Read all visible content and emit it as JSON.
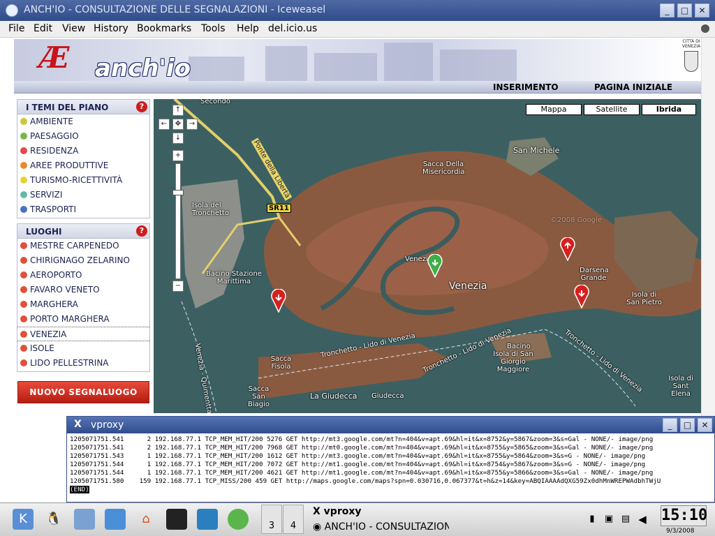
{
  "window": {
    "title": "ANCH'IO - CONSULTAZIONE DELLE SEGNALAZIONI - Iceweasel",
    "menu": [
      "File",
      "Edit",
      "View",
      "History",
      "Bookmarks",
      "Tools",
      "Help",
      "del.icio.us"
    ]
  },
  "banner": {
    "logo_text": "anch'io",
    "city_logo_text": "CITTÀ DI VENEZIA"
  },
  "nav": {
    "inserimento": "INSERIMENTO",
    "pagina_iniziale": "PAGINA INIZIALE"
  },
  "temi": {
    "title": "I TEMI DEL PIANO",
    "help": "?",
    "items": [
      {
        "label": "AMBIENTE",
        "color": "#c8c83a"
      },
      {
        "label": "PAESAGGIO",
        "color": "#7ab648"
      },
      {
        "label": "RESIDENZA",
        "color": "#e04a4a"
      },
      {
        "label": "AREE PRODUTTIVE",
        "color": "#e98a2a"
      },
      {
        "label": "TURISMO-RICETTIVITÀ",
        "color": "#e8d23a"
      },
      {
        "label": "SERVIZI",
        "color": "#62b9a8"
      },
      {
        "label": "TRASPORTI",
        "color": "#4a6fc4"
      }
    ]
  },
  "luoghi": {
    "title": "LUOGHI",
    "help": "?",
    "items": [
      "MESTRE CARPENEDO",
      "CHIRIGNAGO ZELARINO",
      "AEROPORTO",
      "FAVARO VENETO",
      "MARGHERA",
      "PORTO MARGHERA",
      "VENEZIA",
      "ISOLE",
      "LIDO PELLESTRINA"
    ],
    "selected": "VENEZIA",
    "dot_color": "#e0503a"
  },
  "new_button": "NUOVO SEGNALUOGO",
  "map": {
    "types": [
      "Mappa",
      "Satellite",
      "Ibrida"
    ],
    "active_type": "Ibrida",
    "labels": {
      "secondo": "Secondo",
      "ponte": "Ponte della Libertà",
      "sr11": "SR11",
      "isola_tronchetto": "Isola del Tronchetto",
      "sacca_misericordia": "Sacca Della Misericordia",
      "san_michele": "San Michele",
      "bacino_marittima": "Bacino Stazione Marittima",
      "venezia_small": "Venezia",
      "venezia": "Venezia",
      "darsena": "Darsena Grande",
      "isola_san_pietro": "Isola di San Pietro",
      "bacino": "Bacino",
      "san_giorgio": "Isola di San Giorgio Maggiore",
      "sacca_fisola": "Sacca Fisola",
      "sacca_san_biagio": "Sacca San Biagio",
      "giudecca": "La Giudecca",
      "giudecca2": "Giudecca",
      "tronchetto_lido": "Tronchetto - Lido di Venezia",
      "tronchetto_lido2": "Tronchetto - Lido di Venezia",
      "canal_lido": "Tronchetto - Lido di Venezia",
      "venezia_quimentta": "Venezia - Quimentta",
      "isola_sant_elena": "Isola di Sant Elena",
      "copyright": "©2008 Google"
    }
  },
  "vproxy": {
    "title": "vproxy",
    "lines": [
      "1205071751.541      2 192.168.77.1 TCP_MEM_HIT/200 5276 GET http://mt3.google.com/mt?n=404&v=apt.69&hl=it&x=8752&y=5867&zoom=3&s=Gal - NONE/- image/png",
      "1205071751.541      2 192.168.77.1 TCP_MEM_HIT/200 7968 GET http://mt0.google.com/mt?n=404&v=apt.69&hl=it&x=8755&y=5865&zoom=3&s=Gal - NONE/- image/png",
      "1205071751.543      1 192.168.77.1 TCP_MEM_HIT/200 1612 GET http://mt3.google.com/mt?n=404&v=apt.69&hl=it&x=8755&y=5864&zoom=3&s=G - NONE/- image/png",
      "1205071751.544      1 192.168.77.1 TCP_MEM_HIT/200 7072 GET http://mt1.google.com/mt?n=404&v=apt.69&hl=it&x=8754&y=5867&zoom=3&s=G - NONE/- image/png",
      "1205071751.544      1 192.168.77.1 TCP_MEM_HIT/200 4621 GET http://mt1.google.com/mt?n=404&v=apt.69&hl=it&x=8755&y=5866&zoom=3&s=Gal - NONE/- image/png",
      "1205071751.580    159 192.168.77.1 TCP_MISS/200 459 GET http://maps.google.com/maps?spn=0.030716,0.067377&t=h&z=14&key=ABQIAAAAdQXG59Zx0dhMnWREPWAdbhTWjU"
    ],
    "end": "(END)"
  },
  "taskbar": {
    "desktops": [
      "3",
      "4"
    ],
    "tasks": [
      "vproxy",
      "ANCH'IO - CONSULTAZIONE"
    ],
    "clock": "15:10",
    "date": "9/3/2008"
  }
}
